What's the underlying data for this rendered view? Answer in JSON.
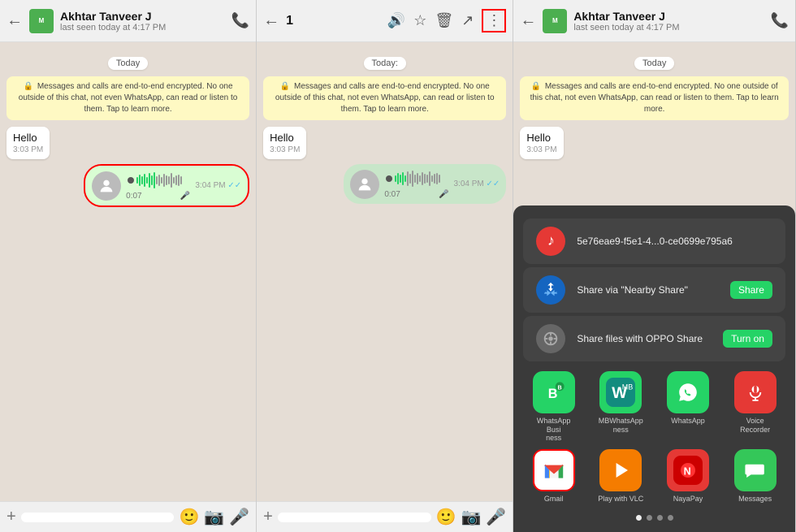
{
  "panels": {
    "panel1": {
      "header": {
        "contact_name": "Akhtar Tanveer J",
        "status": "last seen today at 4:17 PM",
        "back_label": "←",
        "call_icon": "📞"
      },
      "chat": {
        "date_label": "Today",
        "system_message": "Messages and calls are end-to-end encrypted. No one outside of this chat, not even WhatsApp, can read or listen to them. Tap to learn more.",
        "messages": [
          {
            "type": "text",
            "direction": "incoming",
            "text": "Hello",
            "time": "3:03 PM"
          },
          {
            "type": "voice",
            "direction": "outgoing",
            "duration": "0:07",
            "time": "3:04 PM"
          }
        ]
      },
      "bottom_bar": {
        "plus_icon": "+",
        "mic_icon": "🎤",
        "camera_icon": "📷",
        "sticker_icon": "😊"
      }
    },
    "panel2": {
      "header": {
        "back_label": "←",
        "count": "1",
        "icons": [
          "🔊",
          "☆",
          "🗑",
          "↗",
          "⋮"
        ]
      },
      "chat": {
        "date_label": "Today:",
        "system_message": "Messages and calls are end-to-end encrypted. No one outside of this chat, not even WhatsApp, can read or listen to them. Tap to learn more.",
        "messages": [
          {
            "type": "text",
            "direction": "incoming",
            "text": "Hello",
            "time": "3:03 PM"
          },
          {
            "type": "voice",
            "direction": "outgoing",
            "duration": "0:07",
            "time": "3:04 PM",
            "selected": true
          }
        ]
      },
      "bottom_bar": {
        "plus_icon": "+",
        "mic_icon": "🎤",
        "camera_icon": "📷",
        "sticker_icon": "😊"
      }
    },
    "panel3": {
      "header": {
        "contact_name": "Akhtar Tanveer J",
        "status": "last seen today at 4:17 PM",
        "back_label": "←",
        "call_icon": "📞"
      },
      "chat": {
        "date_label": "Today",
        "system_message": "Messages and calls are end-to-end encrypted. No one outside of this chat, not even WhatsApp, can read or listen to them. Tap to learn more.",
        "messages": [
          {
            "type": "text",
            "direction": "incoming",
            "text": "Hello",
            "time": "3:03 PM"
          }
        ]
      },
      "share_sheet": {
        "file_item": {
          "icon_color": "#e53935",
          "icon": "♪",
          "filename": "5e76eae9-f5e1-4...0-ce0699e795a6"
        },
        "nearby_share": {
          "label": "Share via \"Nearby Share\"",
          "button": "Share"
        },
        "oppo_share": {
          "label": "Share files with OPPO Share",
          "button": "Turn on"
        },
        "apps": [
          {
            "name": "WhatsApp Business",
            "label": "WhatsApp Busi\nness",
            "color": "#25d366",
            "icon": "B",
            "outlined": false
          },
          {
            "name": "MBWhatsApp",
            "label": "MBWhatsApp ness",
            "color": "#25d366",
            "icon": "M",
            "outlined": false
          },
          {
            "name": "WhatsApp",
            "label": "WhatsApp",
            "color": "#25d366",
            "icon": "W",
            "outlined": false
          },
          {
            "name": "Voice Recorder",
            "label": "Voice Recorder",
            "color": "#e53935",
            "icon": "🎤",
            "outlined": false
          },
          {
            "name": "Gmail",
            "label": "Gmail",
            "color": "#fff",
            "icon": "M",
            "outlined": true
          },
          {
            "name": "Play with VLC",
            "label": "Play with VLC",
            "color": "#f57c00",
            "icon": "▶",
            "outlined": false
          },
          {
            "name": "NayaPay",
            "label": "NayaPay",
            "color": "#e53935",
            "icon": "N",
            "outlined": false
          },
          {
            "name": "Messages",
            "label": "Messages",
            "color": "#34c759",
            "icon": "💬",
            "outlined": false
          }
        ],
        "dots": [
          true,
          false,
          false,
          false
        ]
      }
    }
  }
}
